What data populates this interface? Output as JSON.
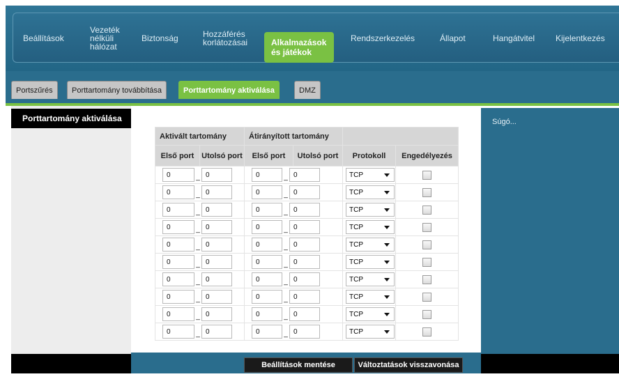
{
  "nav": {
    "items": [
      {
        "label": "Beállítások"
      },
      {
        "label": "Vezeték nélküli hálózat"
      },
      {
        "label": "Biztonság"
      },
      {
        "label": "Hozzáférés korlátozásai"
      },
      {
        "label": "Alkalmazások és játékok"
      },
      {
        "label": "Rendszerkezelés"
      },
      {
        "label": "Állapot"
      },
      {
        "label": "Hangátvitel"
      },
      {
        "label": "Kijelentkezés"
      }
    ]
  },
  "tabs": [
    {
      "label": "Portszűrés"
    },
    {
      "label": "Porttartomány továbbítása"
    },
    {
      "label": "Porttartomány aktiválása"
    },
    {
      "label": "DMZ"
    }
  ],
  "sidebar": {
    "heading": "Porttartomány aktiválása"
  },
  "help": {
    "label": "Súgó..."
  },
  "table": {
    "group_headers": {
      "triggered": "Aktivált tartomány",
      "forwarded": "Átirányított tartomány"
    },
    "columns": {
      "first_port": "Első port",
      "last_port": "Utolsó port",
      "protocol": "Protokoll",
      "enable": "Engedélyezés"
    },
    "rows": [
      {
        "t_first": "0",
        "t_last": "0",
        "f_first": "0",
        "f_last": "0",
        "protocol": "TCP",
        "enabled": false
      },
      {
        "t_first": "0",
        "t_last": "0",
        "f_first": "0",
        "f_last": "0",
        "protocol": "TCP",
        "enabled": false
      },
      {
        "t_first": "0",
        "t_last": "0",
        "f_first": "0",
        "f_last": "0",
        "protocol": "TCP",
        "enabled": false
      },
      {
        "t_first": "0",
        "t_last": "0",
        "f_first": "0",
        "f_last": "0",
        "protocol": "TCP",
        "enabled": false
      },
      {
        "t_first": "0",
        "t_last": "0",
        "f_first": "0",
        "f_last": "0",
        "protocol": "TCP",
        "enabled": false
      },
      {
        "t_first": "0",
        "t_last": "0",
        "f_first": "0",
        "f_last": "0",
        "protocol": "TCP",
        "enabled": false
      },
      {
        "t_first": "0",
        "t_last": "0",
        "f_first": "0",
        "f_last": "0",
        "protocol": "TCP",
        "enabled": false
      },
      {
        "t_first": "0",
        "t_last": "0",
        "f_first": "0",
        "f_last": "0",
        "protocol": "TCP",
        "enabled": false
      },
      {
        "t_first": "0",
        "t_last": "0",
        "f_first": "0",
        "f_last": "0",
        "protocol": "TCP",
        "enabled": false
      },
      {
        "t_first": "0",
        "t_last": "0",
        "f_first": "0",
        "f_last": "0",
        "protocol": "TCP",
        "enabled": false
      }
    ],
    "range_separator": "_"
  },
  "buttons": {
    "save": "Beállítások mentése",
    "cancel": "Változtatások visszavonása"
  },
  "colors": {
    "accent": "#7ac143",
    "panel": "#2a6d8d"
  }
}
